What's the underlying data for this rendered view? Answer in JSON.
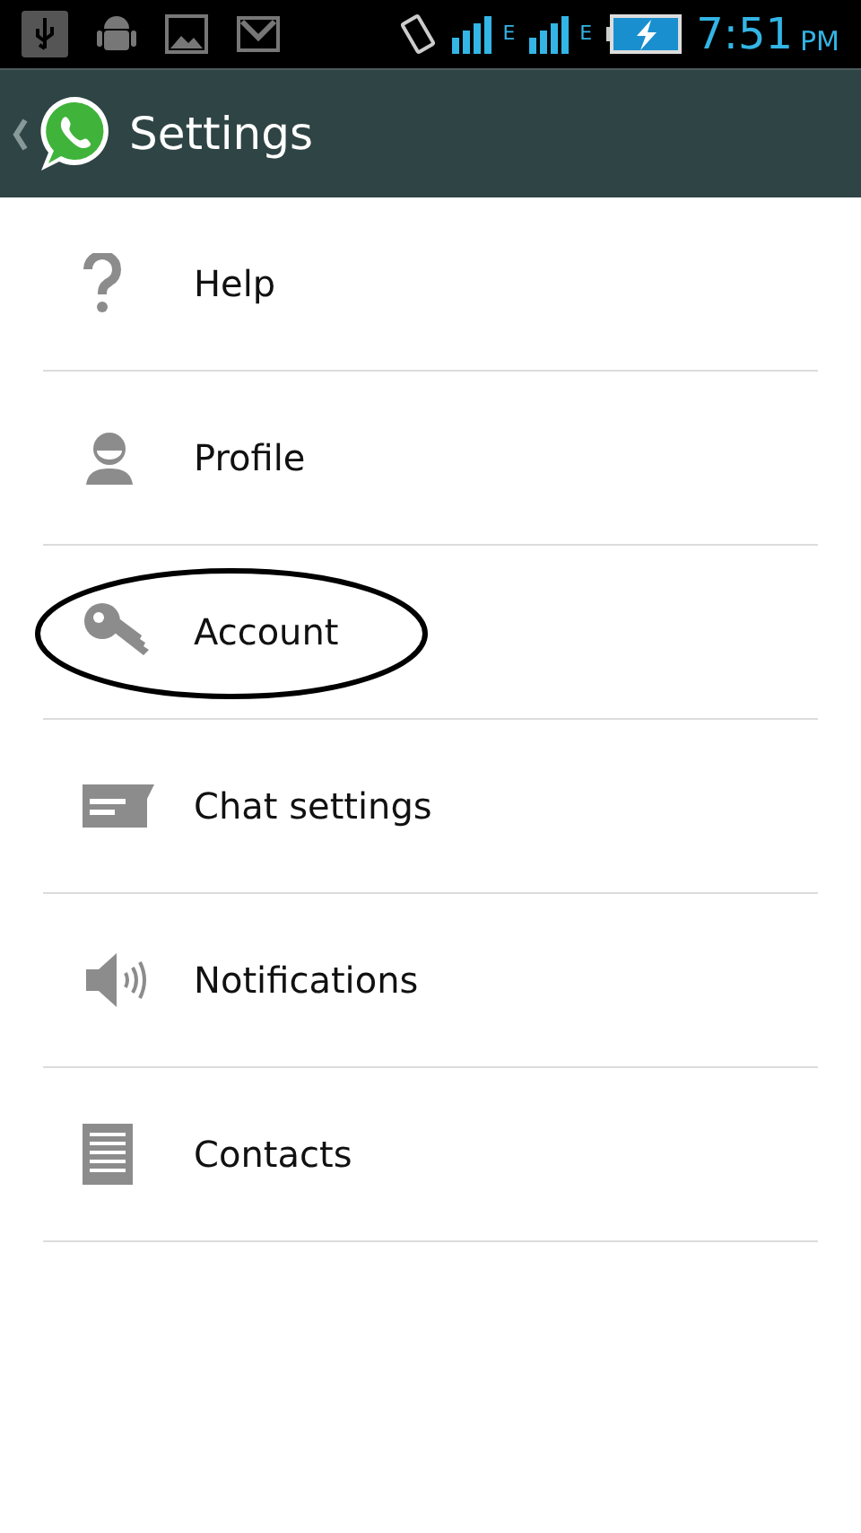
{
  "status_bar": {
    "network_1": "E",
    "network_2": "E",
    "time": "7:51",
    "period": "PM"
  },
  "header": {
    "title": "Settings"
  },
  "items": [
    {
      "kind": "help",
      "label": "Help",
      "circled": false
    },
    {
      "kind": "profile",
      "label": "Profile",
      "circled": false
    },
    {
      "kind": "account",
      "label": "Account",
      "circled": true
    },
    {
      "kind": "chat",
      "label": "Chat settings",
      "circled": false
    },
    {
      "kind": "notifications",
      "label": "Notifications",
      "circled": false
    },
    {
      "kind": "contacts",
      "label": "Contacts",
      "circled": false
    }
  ]
}
